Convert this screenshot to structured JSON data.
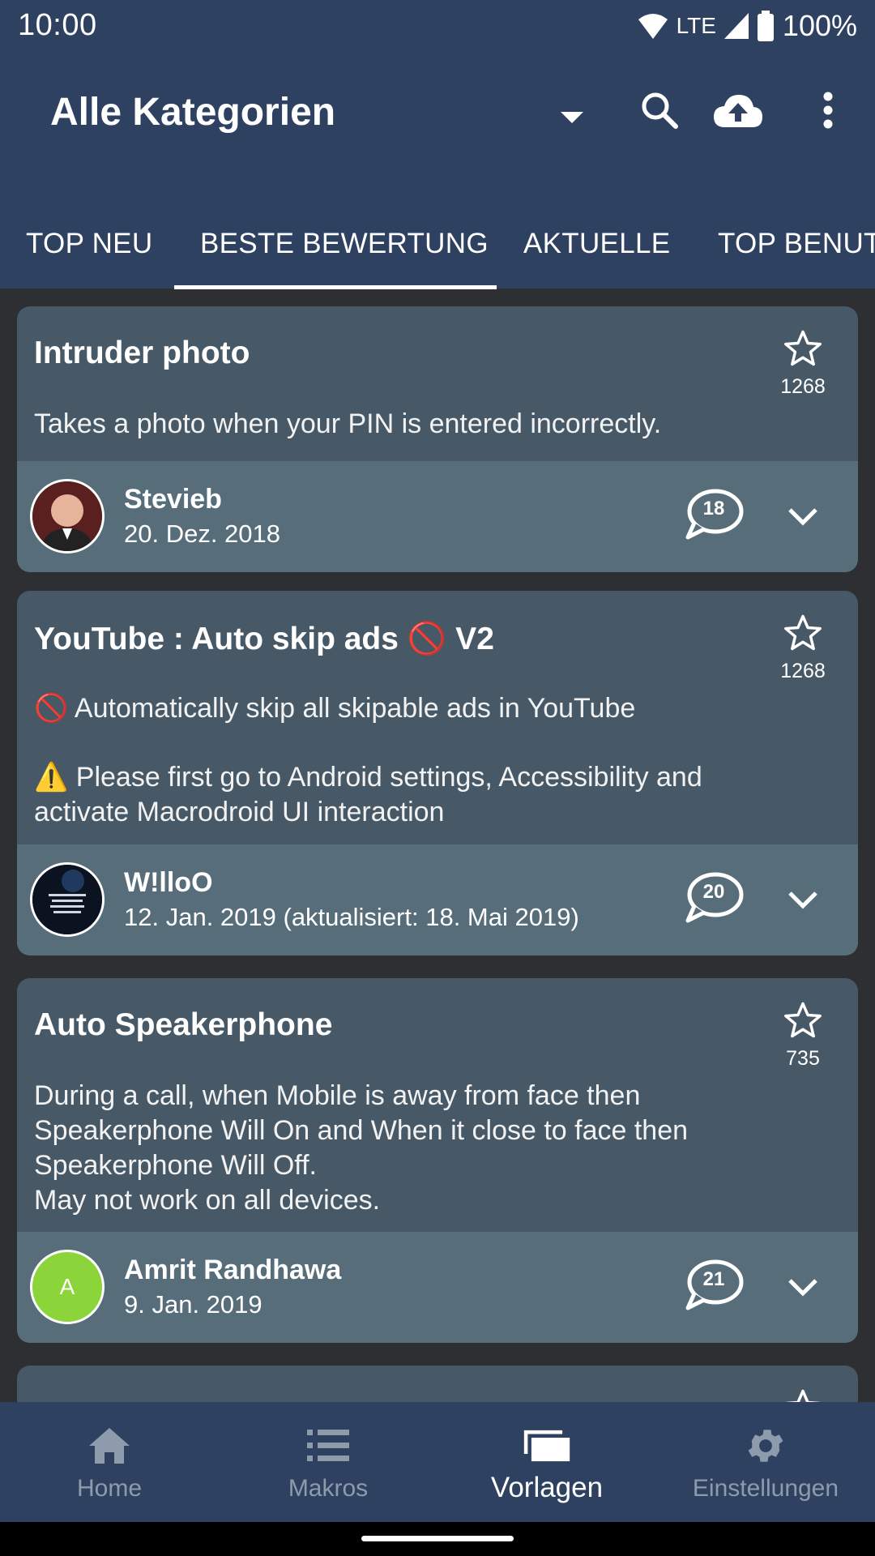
{
  "status_bar": {
    "time": "10:00",
    "network": "LTE",
    "battery": "100%"
  },
  "app_bar": {
    "title": "Alle Kategorien"
  },
  "tabs": [
    {
      "label": "TOP NEU"
    },
    {
      "label": "BESTE BEWERTUNG",
      "active": true
    },
    {
      "label": "AKTUELLE"
    },
    {
      "label": "TOP BENUT"
    }
  ],
  "cards": [
    {
      "title": "Intruder photo",
      "description": "Takes a photo when your PIN is entered incorrectly.",
      "stars": "1268",
      "author": "Stevieb",
      "date": "20. Dez. 2018",
      "comments": "18"
    },
    {
      "title": "YouTube : Auto skip ads 🚫 V2",
      "description_line1": "🚫 Automatically skip all skipable ads in YouTube",
      "description_line2": "⚠️ Please first go to Android settings, Accessibility and activate Macrodroid UI interaction",
      "stars": "1268",
      "author": "W!lloO",
      "date": "12. Jan. 2019 (aktualisiert: 18. Mai 2019)",
      "comments": "20"
    },
    {
      "title": "Auto Speakerphone",
      "description": "During a call, when Mobile is away from face then Speakerphone Will On and When it close to face then Speakerphone Will Off.\nMay not work on all devices.",
      "stars": "735",
      "author": "Amrit Randhawa",
      "avatar_letter": "A",
      "avatar_color": "#8bd43a",
      "date": "9. Jan. 2019",
      "comments": "21"
    }
  ],
  "bottom_nav": [
    {
      "label": "Home",
      "icon": "home-icon"
    },
    {
      "label": "Makros",
      "icon": "list-icon"
    },
    {
      "label": "Vorlagen",
      "icon": "templates-icon",
      "active": true
    },
    {
      "label": "Einstellungen",
      "icon": "gear-icon"
    }
  ],
  "colors": {
    "primary": "#2e4160",
    "card": "#475866",
    "card_footer": "#576e7a",
    "background": "#2e2f33"
  }
}
